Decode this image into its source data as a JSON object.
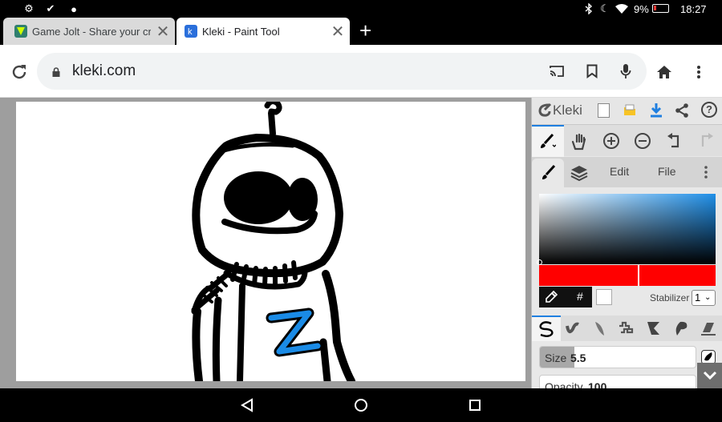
{
  "status_bar": {
    "battery": "9%",
    "time": "18:27"
  },
  "tabs": [
    {
      "title": "Game Jolt - Share your creat",
      "active": false
    },
    {
      "title": "Kleki - Paint Tool",
      "active": true
    }
  ],
  "address_bar": {
    "url": "kleki.com"
  },
  "kleki": {
    "logo_text": "Kleki",
    "panel_tabs": {
      "edit": "Edit",
      "file": "File"
    },
    "stabilizer_label": "Stabilizer",
    "stabilizer_value": "1",
    "stabilizer_options": [
      "1"
    ],
    "hex_symbol": "#",
    "size_label": "Size",
    "size_value": "5.5",
    "size_fraction": 0.22,
    "opacity_label": "Opacity",
    "opacity_value": "100",
    "primary_color": "#ff0000",
    "secondary_color": "#ffffff",
    "hue_color": "#1f8fe8",
    "brushes": [
      "pen-brush",
      "blend-brush",
      "sketchy-brush",
      "pixel-brush",
      "chemy-brush",
      "smudge-brush",
      "eraser"
    ]
  },
  "colors": {
    "accent": "#1f7fe0",
    "drawing_blue": "#1a8be6"
  }
}
